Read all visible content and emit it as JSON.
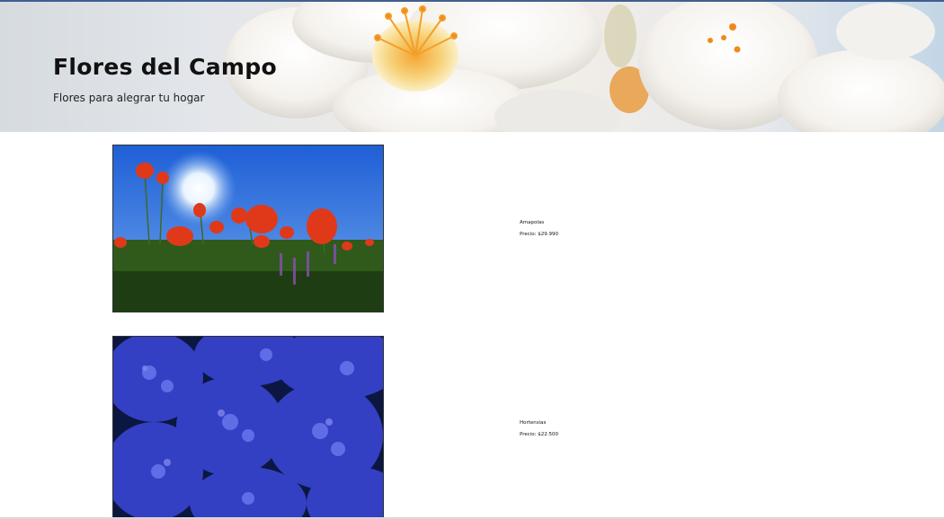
{
  "header": {
    "title": "Flores del Campo",
    "subtitle": "Flores para alegrar tu hogar",
    "banner_image": "white-blossom-flower-photo"
  },
  "products": [
    {
      "name": "Amapolas",
      "price": "Precio: $29.990",
      "image": "red-poppy-field-photo"
    },
    {
      "name": "Hortensias",
      "price": "Precio: $22.500",
      "image": "blue-hydrangea-photo"
    }
  ],
  "colors": {
    "banner_sky": "#c3d6e6",
    "poppy_red": "#e0391a",
    "sky_blue": "#2d6be0",
    "hydrangea_blue": "#4a58d6"
  }
}
